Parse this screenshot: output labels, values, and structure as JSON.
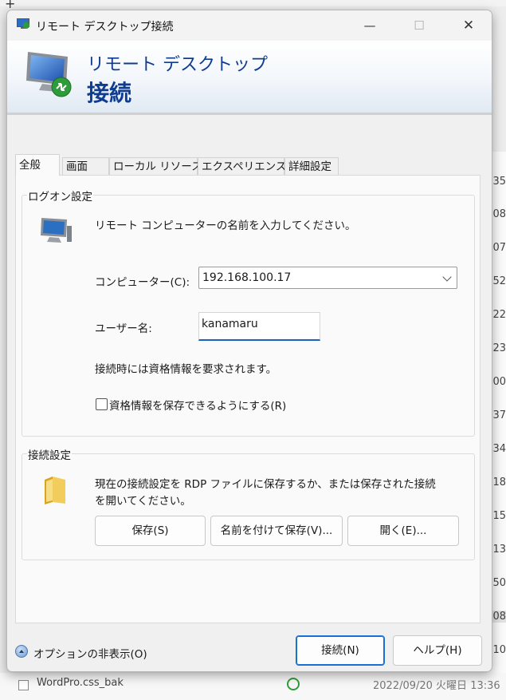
{
  "window": {
    "title": "リモート デスクトップ接続",
    "minimize_glyph": "—",
    "maximize_glyph": "☐",
    "close_glyph": "✕"
  },
  "banner": {
    "line1": "リモート デスクトップ",
    "line2": "接続"
  },
  "tabs": [
    "全般",
    "画面",
    "ローカル リソース",
    "エクスペリエンス",
    "詳細設定"
  ],
  "logon": {
    "group_title": "ログオン設定",
    "instruction": "リモート コンピューターの名前を入力してください。",
    "computer_label": "コンピューター(C):",
    "computer_value": "192.168.100.17",
    "username_label": "ユーザー名:",
    "username_value": "kanamaru",
    "credential_note": "接続時には資格情報を要求されます。",
    "save_credentials_label": "資格情報を保存できるようにする(R)",
    "save_credentials_checked": false
  },
  "connection": {
    "group_title": "接続設定",
    "description_line1": "現在の接続設定を RDP ファイルに保存するか、または保存された接続",
    "description_line2": "を開いてください。",
    "save_button": "保存(S)",
    "save_as_button": "名前を付けて保存(V)...",
    "open_button": "開く(E)..."
  },
  "footer": {
    "options_label": "オプションの非表示(O)",
    "connect_button": "接続(N)",
    "help_button": "ヘルプ(H)"
  },
  "background": {
    "right_column_values": [
      "35",
      "08",
      "07",
      ":52",
      ":22",
      ":23",
      ":00",
      ":37",
      ":34",
      ":18",
      ":15",
      ":13",
      ":50",
      "08",
      ":10",
      "13:36"
    ],
    "file_name": "WordPro.css_bak",
    "file_date": "2022/09/20 火曜日 13:36"
  },
  "colors": {
    "banner_text": "#0f3c8e",
    "focus_underline": "#1565c0",
    "primary_border": "#1a6fd0"
  }
}
